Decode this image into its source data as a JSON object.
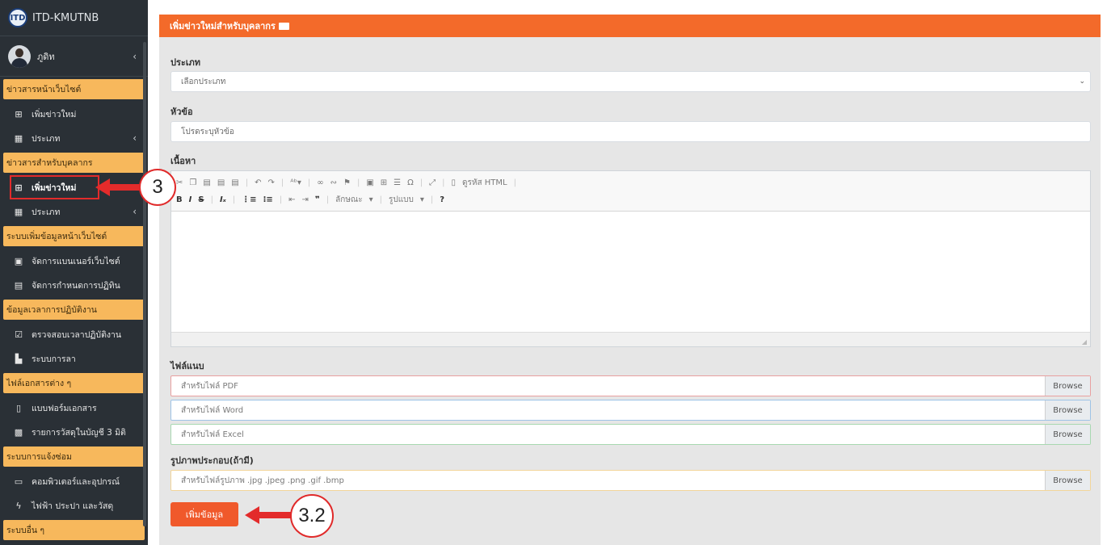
{
  "app": {
    "brand": "ITD-KMUTNB",
    "logo_text": "ITD"
  },
  "user": {
    "name": "ภูดิท"
  },
  "sidebar": {
    "sections": [
      {
        "title": "ข่าวสารหน้าเว็บไซต์",
        "items": [
          {
            "label": "เพิ่มข่าวใหม่",
            "icon": "plus-square-icon"
          },
          {
            "label": "ประเภท",
            "icon": "grid-icon",
            "chevron": true
          }
        ]
      },
      {
        "title": "ข่าวสารสำหรับบุคลากร",
        "items": [
          {
            "label": "เพิ่มข่าวใหม่",
            "icon": "plus-square-icon",
            "active": true
          },
          {
            "label": "ประเภท",
            "icon": "grid-icon",
            "chevron": true
          }
        ]
      },
      {
        "title": "ระบบเพิ่มข้อมูลหน้าเว็บไซต์",
        "items": [
          {
            "label": "จัดการแบนเนอร์เว็บไซต์",
            "icon": "image-icon"
          },
          {
            "label": "จัดการกำหนดการปฏิทิน",
            "icon": "calendar-icon"
          }
        ]
      },
      {
        "title": "ข้อมูลเวลาการปฏิบัติงาน",
        "items": [
          {
            "label": "ตรวจสอบเวลาปฏิบัติงาน",
            "icon": "calendar-check-icon"
          },
          {
            "label": "ระบบการลา",
            "icon": "scroll-icon"
          }
        ]
      },
      {
        "title": "ไฟล์เอกสารต่าง ๆ",
        "items": [
          {
            "label": "แบบฟอร์มเอกสาร",
            "icon": "file-icon"
          },
          {
            "label": "รายการวัสดุในบัญชี 3 มิติ",
            "icon": "box-icon"
          }
        ]
      },
      {
        "title": "ระบบการแจ้งซ่อม",
        "items": [
          {
            "label": "คอมพิวเตอร์และอุปกรณ์",
            "icon": "monitor-icon"
          },
          {
            "label": "ไฟฟ้า ประปา และวัสดุ",
            "icon": "bolt-icon"
          }
        ]
      },
      {
        "title": "ระบบอื่น ๆ",
        "items": []
      }
    ]
  },
  "panel": {
    "title": "เพิ่มข่าวใหม่สำหรับบุคลากร",
    "type_label": "ประเภท",
    "type_value": "เลือกประเภท",
    "subject_label": "หัวข้อ",
    "subject_placeholder": "โปรดระบุหัวข้อ",
    "content_label": "เนื้อหา",
    "toolbar": {
      "source_label": "ดูรหัส HTML",
      "style_label": "ลักษณะ",
      "format_label": "รูปแบบ",
      "help": "?"
    },
    "attach_label": "ไฟล์แนบ",
    "pdf_placeholder": "สำหรับไฟล์ PDF",
    "word_placeholder": "สำหรับไฟล์ Word",
    "excel_placeholder": "สำหรับไฟล์ Excel",
    "image_label": "รูปภาพประกอบ(ถ้ามี)",
    "image_placeholder": "สำหรับไฟล์รูปภาพ .jpg .jpeg .png .gif .bmp",
    "browse": "Browse",
    "submit": "เพิ่มข้อมูล",
    "colors": {
      "pdf_border": "#e8a0a0",
      "word_border": "#9ec3e6",
      "excel_border": "#a8d8b0",
      "image_border": "#f2d59a"
    }
  },
  "annotations": {
    "step_a": "3",
    "step_b": "3.2",
    "color": "#e02a2a"
  }
}
